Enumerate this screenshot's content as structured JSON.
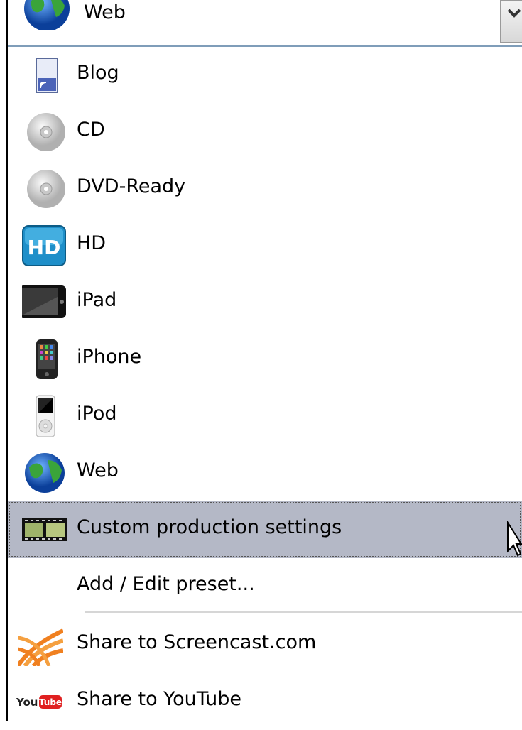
{
  "combo": {
    "selected_label": "Web"
  },
  "items": [
    {
      "label": "Blog",
      "icon": "blog-icon"
    },
    {
      "label": "CD",
      "icon": "cd-icon"
    },
    {
      "label": "DVD-Ready",
      "icon": "dvd-icon"
    },
    {
      "label": "HD",
      "icon": "hd-icon"
    },
    {
      "label": "iPad",
      "icon": "ipad-icon"
    },
    {
      "label": "iPhone",
      "icon": "iphone-icon"
    },
    {
      "label": "iPod",
      "icon": "ipod-icon"
    },
    {
      "label": "Web",
      "icon": "globe-icon"
    },
    {
      "label": "Custom production settings",
      "icon": "film-strip-icon",
      "selected": true
    },
    {
      "label": "Add / Edit preset...",
      "icon": ""
    },
    {
      "label": "Share to Screencast.com",
      "icon": "screencast-icon"
    },
    {
      "label": "Share to YouTube",
      "icon": "youtube-icon"
    }
  ],
  "colors": {
    "selection": "#b4b8c6",
    "combo_border": "#7f9db9"
  }
}
